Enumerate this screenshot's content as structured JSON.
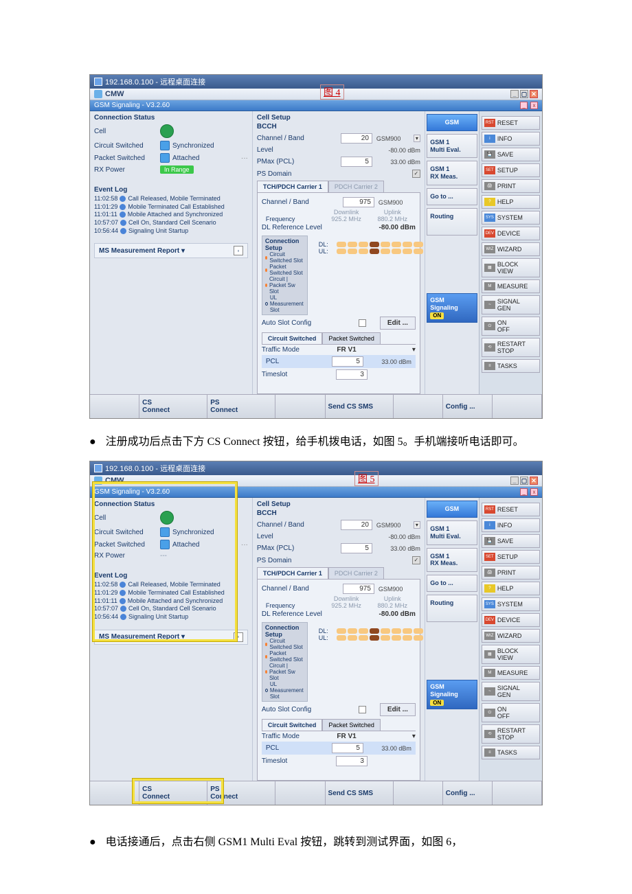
{
  "doc": {
    "caption1": "图 4",
    "caption2": "图 5",
    "instruction1_bullet": "●",
    "instruction1_text": "注册成功后点击下方 CS Connect 按钮，给手机拨电话，如图 5。手机端接听电话即可。",
    "instruction2_bullet": "●",
    "instruction2_text": "电话接通后，点击右侧 GSM1 Multi Eval 按钮，跳转到测试界面，如图 6，"
  },
  "remote_title": "192.168.0.100 - 远程桌面连接",
  "cmw_title": "CMW",
  "sig_title": "GSM Signaling  - V3.2.60",
  "conn_status_title": "Connection Status",
  "cell_label": "Cell",
  "circuit_switched": {
    "label": "Circuit Switched",
    "value": "Synchronized"
  },
  "packet_switched": {
    "label": "Packet Switched",
    "value": "Attached"
  },
  "rx_power": {
    "label": "RX Power",
    "value": "In Range",
    "value2": "---"
  },
  "event_log_title": "Event Log",
  "events": [
    {
      "time": "11:02:58",
      "msg": "Call Released, Mobile Terminated"
    },
    {
      "time": "11:01:29",
      "msg": "Mobile Terminated Call Established"
    },
    {
      "time": "11:01:11",
      "msg": "Mobile Attached and Synchronized"
    },
    {
      "time": "10:57:07",
      "msg": "Cell On, Standard Cell Scenario"
    },
    {
      "time": "10:56:44",
      "msg": "Signaling Unit Startup"
    }
  ],
  "ms_report": {
    "label": "MS Measurement Report ▾"
  },
  "cell_setup": {
    "title": "Cell Setup",
    "bcch": "BCCH",
    "channel_band_label": "Channel / Band",
    "channel_band_val": "20",
    "channel_band_unit": "GSM900",
    "level_label": "Level",
    "level_val": "-80.00",
    "level_unit": "dBm",
    "pmax_label": "PMax (PCL)",
    "pmax_val": "5",
    "pmax_unit": "33.00  dBm",
    "ps_domain_label": "PS Domain"
  },
  "tabs": {
    "tch": "TCH/PDCH Carrier 1",
    "pdch": "PDCH Carrier 2"
  },
  "carrier": {
    "channel_band_label": "Channel / Band",
    "channel_band_val": "975",
    "channel_band_unit": "GSM900",
    "dl_label": "Downlink",
    "ul_label": "Uplink",
    "freq_label": "Frequency",
    "freq_dl": "925.2  MHz",
    "freq_ul": "880.2  MHz",
    "dl_ref_label": "DL Reference Level",
    "dl_ref_val": "-80.00  dBm"
  },
  "conn_setup": {
    "title": "Connection Setup",
    "line1": "Circuit Switched Slot",
    "line2": "Packet Switched Slot",
    "line3": "Circuit | Packet Sw Slot",
    "line4": "UL Measurement Slot",
    "dl_label": "DL:",
    "ul_label": "UL:"
  },
  "auto_slot": {
    "label": "Auto Slot Config",
    "edit": "Edit ..."
  },
  "tabs2": {
    "cs": "Circuit Switched",
    "ps": "Packet Switched"
  },
  "traffic_mode": {
    "label": "Traffic Mode",
    "val": "FR V1"
  },
  "pcl": {
    "label": "PCL",
    "val": "5",
    "unit": "33.00  dBm"
  },
  "timeslot": {
    "label": "Timeslot",
    "val": "3"
  },
  "side": {
    "gsm": "GSM",
    "gsm1_multi": "GSM 1\nMulti Eval.",
    "gsm1_rx": "GSM 1\nRX Meas.",
    "goto": "Go to ...",
    "routing": "Routing",
    "signaling": "GSM\nSignaling",
    "on": "ON",
    "config": "Config ..."
  },
  "right_buttons": {
    "reset": "RESET",
    "info": "INFO",
    "save": "SAVE",
    "setup": "SETUP",
    "print": "PRINT",
    "help": "HELP",
    "system": "SYSTEM",
    "device": "DEVICE",
    "wizard": "WIZARD",
    "block": "BLOCK\nVIEW",
    "measure": "MEASURE",
    "signal": "SIGNAL\nGEN",
    "onoff": "ON\nOFF",
    "restart": "RESTART\nSTOP",
    "tasks": "TASKS"
  },
  "bottom": {
    "cs_connect": "CS\nConnect",
    "ps_connect": "PS\nConnect",
    "send_sms": "Send CS SMS"
  }
}
